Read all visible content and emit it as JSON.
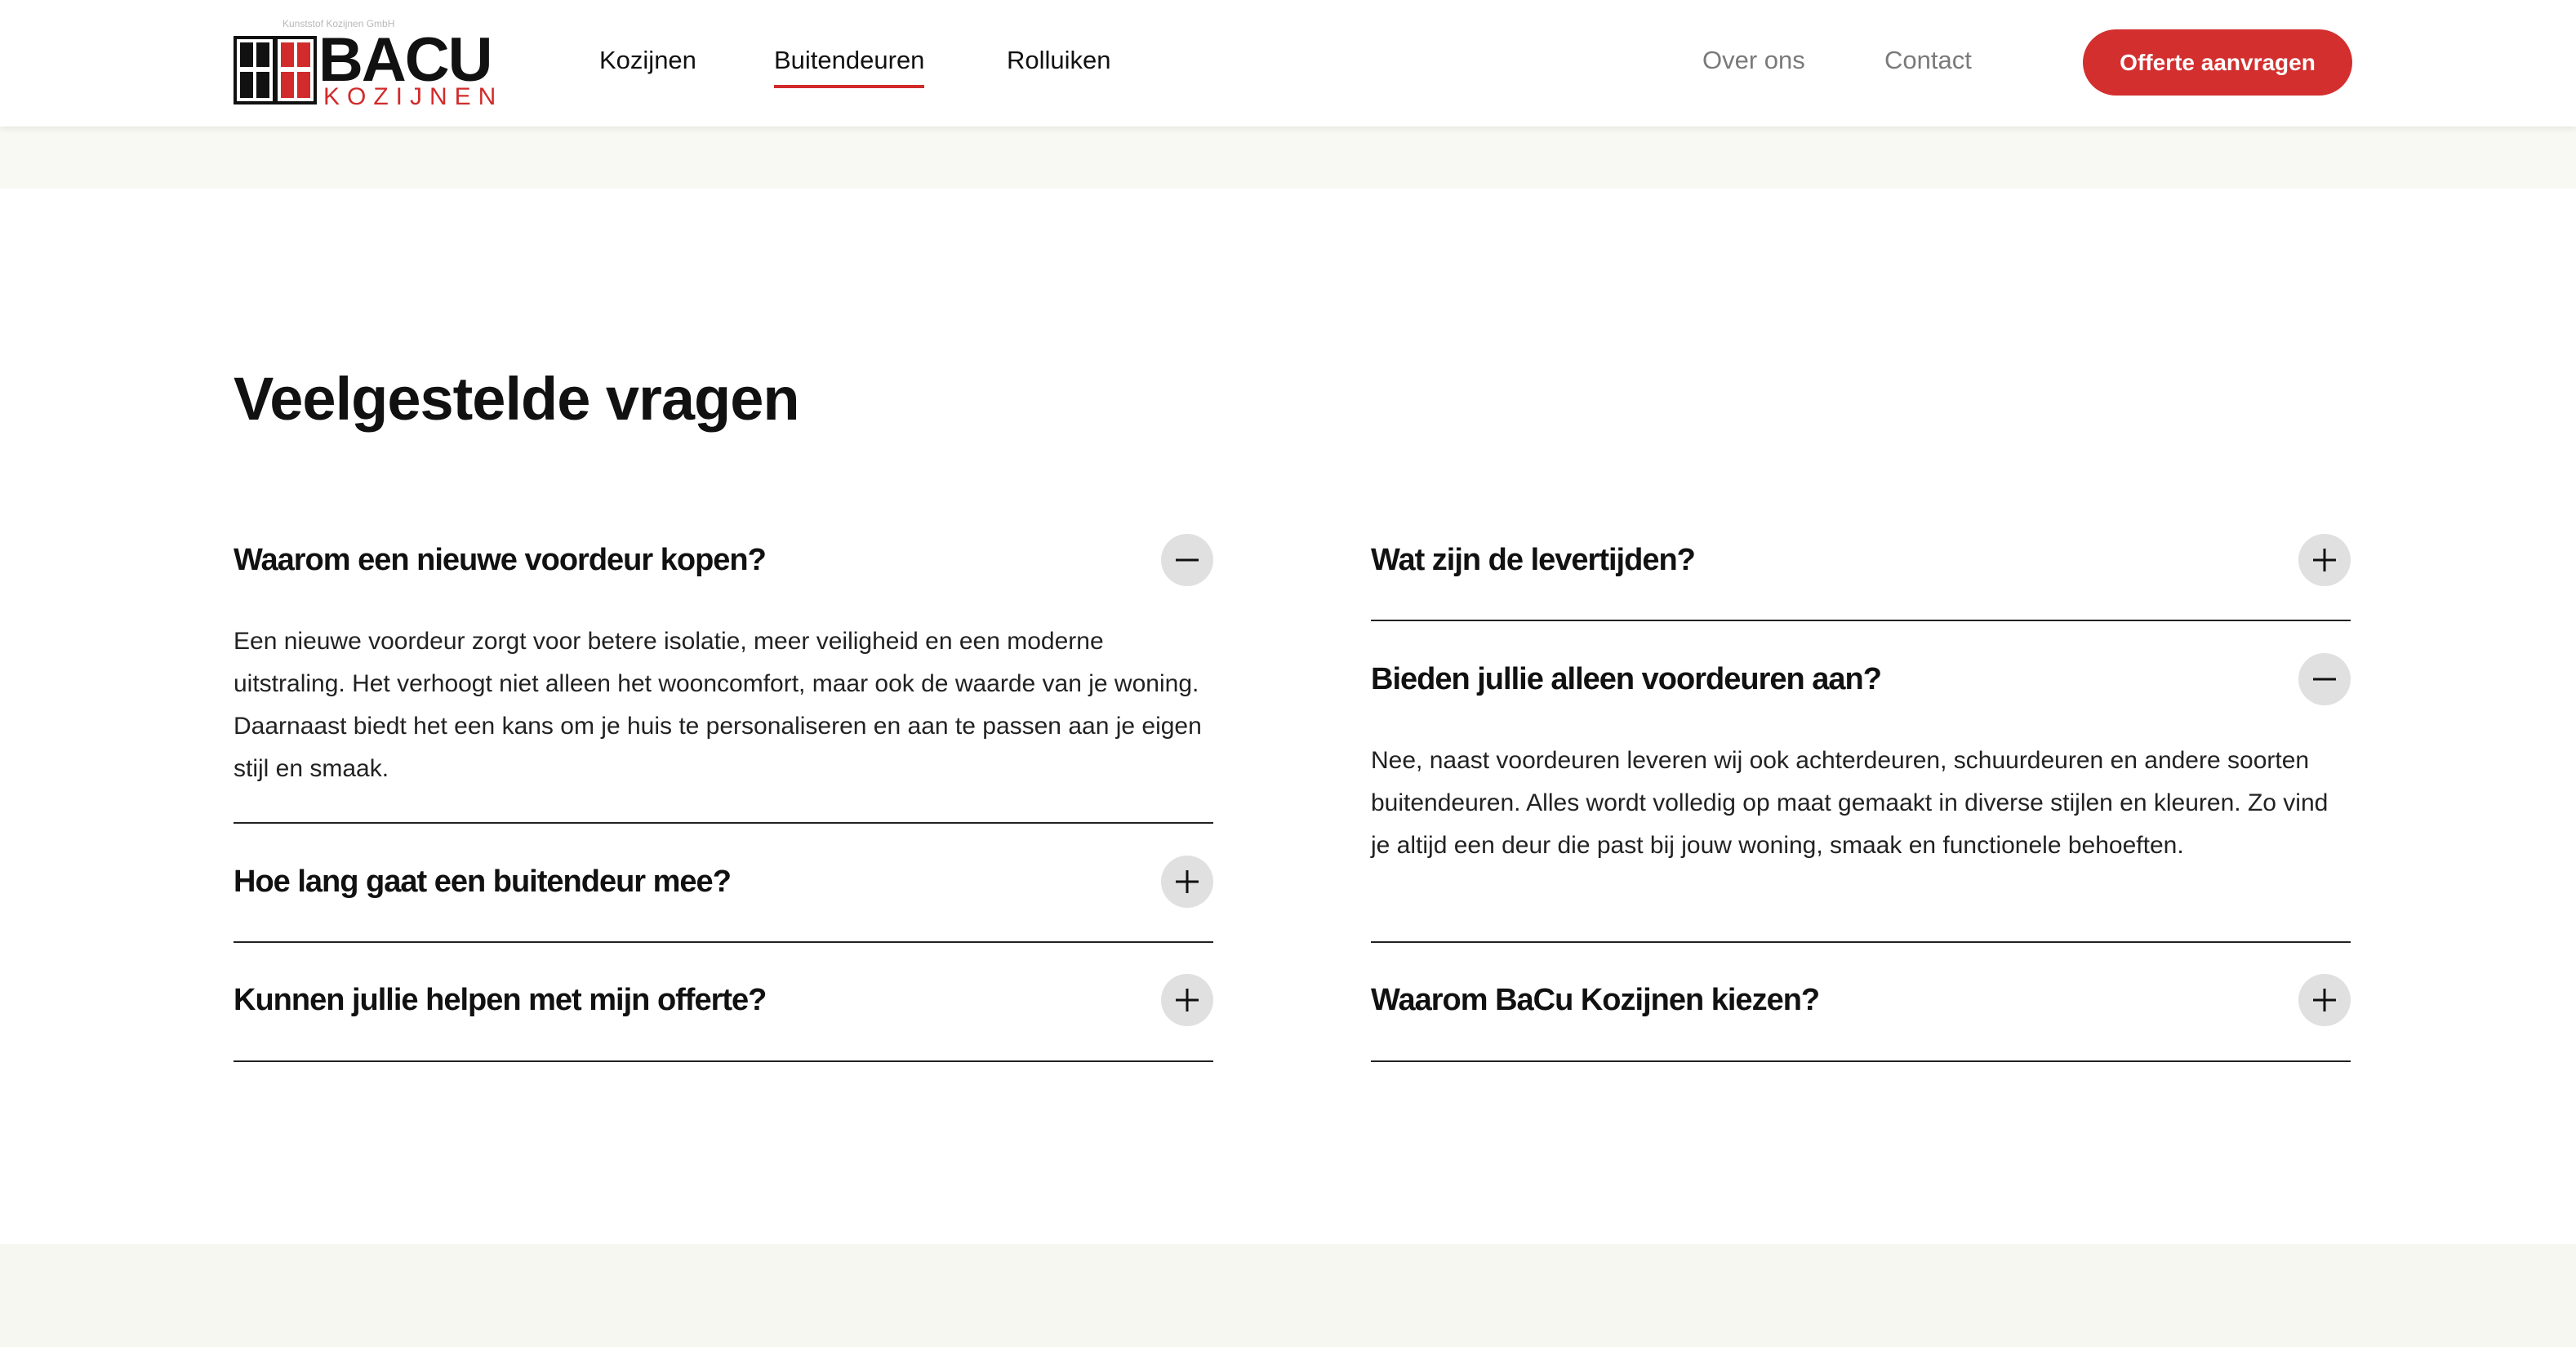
{
  "header": {
    "logo": {
      "tagline": "Kunststof Kozijnen GmbH",
      "brand": "BACU",
      "sub": "KOZIJNEN"
    },
    "nav": [
      "Kozijnen",
      "Buitendeuren",
      "Rolluiken"
    ],
    "secondary_nav": [
      "Over ons",
      "Contact"
    ],
    "active_nav": "Buitendeuren",
    "cta_label": "Offerte aanvragen"
  },
  "colors": {
    "accent": "#d32f2f",
    "beige": "#f9f9f4",
    "toggle_bg": "#e0e0e0"
  },
  "faq": {
    "title": "Veelgestelde vragen",
    "left": [
      {
        "question": "Waarom een nieuwe voordeur kopen?",
        "expanded": true,
        "answer": "Een nieuwe voordeur zorgt voor betere isolatie, meer veiligheid en een moderne uitstraling. Het verhoogt niet alleen het wooncomfort, maar ook de waarde van je woning. Daarnaast biedt het een kans om je huis te personaliseren en aan te passen aan je eigen stijl en smaak."
      },
      {
        "question": "Hoe lang gaat een buitendeur mee?",
        "expanded": false
      },
      {
        "question": "Kunnen jullie helpen met mijn offerte?",
        "expanded": false
      }
    ],
    "right": [
      {
        "question": "Wat zijn de levertijden?",
        "expanded": false
      },
      {
        "question": "Bieden jullie alleen voordeuren aan?",
        "expanded": true,
        "answer": "Nee, naast voordeuren leveren wij ook achterdeuren, schuurdeuren en andere soorten buitendeuren. Alles wordt volledig op maat gemaakt in diverse stijlen en kleuren. Zo vind je altijd een deur die past bij jouw woning, smaak en functionele behoeften."
      },
      {
        "question": "Waarom BaCu Kozijnen kiezen?",
        "expanded": false
      }
    ],
    "icons": {
      "expanded": "minus-icon",
      "collapsed": "plus-icon"
    }
  }
}
